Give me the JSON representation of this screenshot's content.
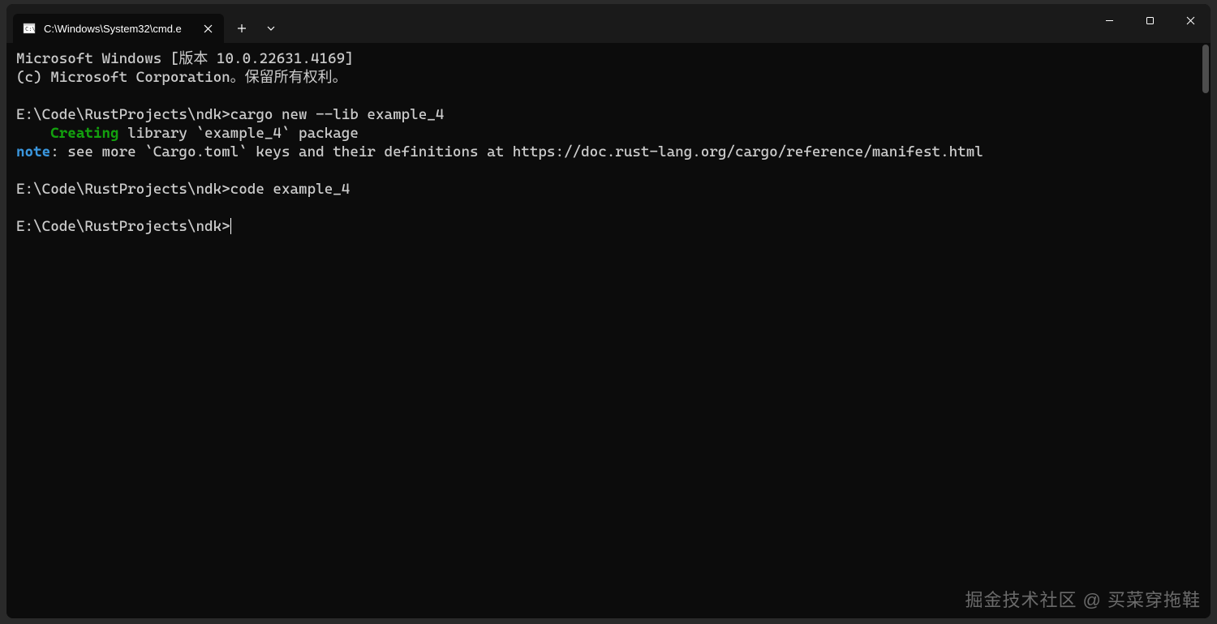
{
  "tab": {
    "title": "C:\\Windows\\System32\\cmd.e"
  },
  "terminal": {
    "line1": "Microsoft Windows [版本 10.0.22631.4169]",
    "line2": "(c) Microsoft Corporation。保留所有权利。",
    "line3_prompt": "E:\\Code\\RustProjects\\ndk>",
    "line3_cmd": "cargo new --lib example_4",
    "line4_indent": "    ",
    "line4_green": "Creating",
    "line4_rest": " library `example_4` package",
    "line5_cyan": "note",
    "line5_rest": ": see more `Cargo.toml` keys and their definitions at https://doc.rust-lang.org/cargo/reference/manifest.html",
    "line6_prompt": "E:\\Code\\RustProjects\\ndk>",
    "line6_cmd": "code example_4",
    "line7_prompt": "E:\\Code\\RustProjects\\ndk>"
  },
  "watermark": "掘金技术社区 @ 买菜穿拖鞋"
}
